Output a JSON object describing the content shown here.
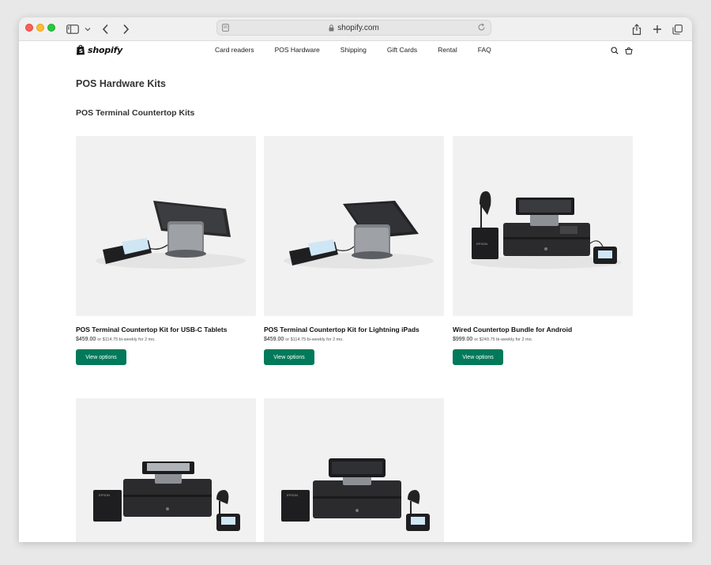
{
  "browser": {
    "url": "shopify.com"
  },
  "brand": {
    "name": "shopify",
    "accent": "#007a5a"
  },
  "nav": {
    "items": [
      "Card readers",
      "POS Hardware",
      "Shipping",
      "Gift Cards",
      "Rental",
      "FAQ"
    ],
    "icons": [
      "search-icon",
      "bag-icon"
    ]
  },
  "page": {
    "title": "POS Hardware Kits",
    "section": "POS Terminal Countertop Kits"
  },
  "products": [
    {
      "title": "POS Terminal Countertop Kit for USB-C Tablets",
      "price": "$459.00",
      "financing": "or $114.75 bi-weekly for 2 mo.",
      "button": "View options"
    },
    {
      "title": "POS Terminal Countertop Kit for Lightning iPads",
      "price": "$459.00",
      "financing": "or $114.75 bi-weekly for 2 mo.",
      "button": "View options"
    },
    {
      "title": "Wired Countertop Bundle for Android",
      "price": "$999.00",
      "financing": "or $249.75 bi-weekly for 2 mo.",
      "button": "View options"
    },
    {
      "title": "",
      "price": "",
      "financing": "",
      "button": ""
    },
    {
      "title": "",
      "price": "",
      "financing": "",
      "button": ""
    }
  ],
  "printer_label": "EPSON"
}
